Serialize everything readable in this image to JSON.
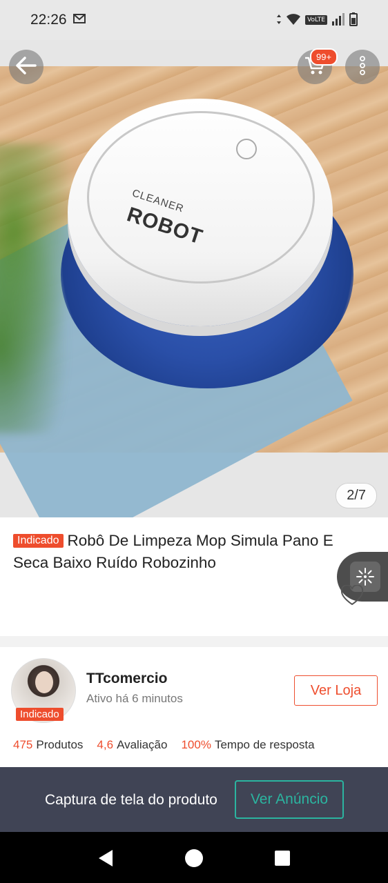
{
  "status_bar": {
    "time": "22:26",
    "network_badge": "VoLTE",
    "icons": [
      "gmail-icon",
      "data-arrows-icon",
      "wifi-icon",
      "signal-icon",
      "battery-icon"
    ]
  },
  "product_image": {
    "robot_label_small": "CLEANER",
    "robot_label_big": "ROBOT",
    "image_counter": "2/7",
    "cart_badge": "99+"
  },
  "product": {
    "tag": "Indicado",
    "title": "Robô De Limpeza Mop Simula Pano E Seca Baixo Ruído Robozinho"
  },
  "shop": {
    "name": "TTcomercio",
    "active_status": "Ativo há 6 minutos",
    "avatar_tag": "Indicado",
    "visit_button": "Ver Loja",
    "stats": {
      "products_count": "475",
      "products_label": "Produtos",
      "rating": "4,6",
      "rating_label": "Avaliação",
      "response_rate": "100%",
      "response_label": "Tempo de resposta"
    }
  },
  "capture_bar": {
    "text": "Captura de tela do produto",
    "button": "Ver Anúncio"
  },
  "colors": {
    "accent": "#ee4d2d",
    "teal": "#2bb5a0",
    "capture_bg": "#404455"
  }
}
